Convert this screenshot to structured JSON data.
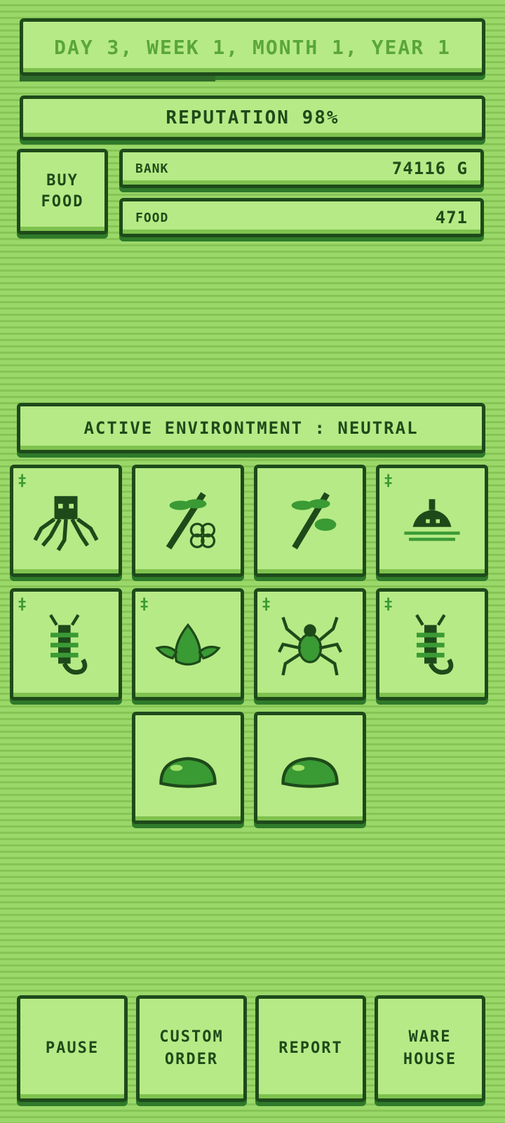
{
  "header": {
    "date_text": "DAY 3, WEEK 1, MONTH 1, YEAR 1",
    "reputation_text": "REPUTATION  98%",
    "date_progress": 0.42
  },
  "stats": {
    "buy_food_line1": "BUY",
    "buy_food_line2": "FOOD",
    "bank_label": "BANK",
    "bank_value": "74116 G",
    "food_label": "FOOD",
    "food_value": "471"
  },
  "environment": {
    "label": "ACTIVE ENVIRONTMENT : NEUTRAL"
  },
  "tiles": [
    {
      "creature": "octopus-icon",
      "plus": "‡"
    },
    {
      "creature": "plant-with-fruit-icon",
      "plus": ""
    },
    {
      "creature": "plant-sprout-icon",
      "plus": ""
    },
    {
      "creature": "water-creature-icon",
      "plus": "‡"
    },
    {
      "creature": "scorpion-icon",
      "plus": "‡"
    },
    {
      "creature": "seed-pod-icon",
      "plus": "‡"
    },
    {
      "creature": "spider-icon",
      "plus": "‡"
    },
    {
      "creature": "scorpion-icon",
      "plus": "‡"
    },
    {
      "creature": "slime-icon",
      "plus": ""
    },
    {
      "creature": "slime-icon",
      "plus": ""
    }
  ],
  "bottom_menu": {
    "pause": "PAUSE",
    "custom_line1": "CUSTOM",
    "custom_line2": "ORDER",
    "report": "REPORT",
    "warehouse_line1": "WARE",
    "warehouse_line2": "HOUSE"
  },
  "colors": {
    "background": "#8fcf5f",
    "panel": "#b6ea86",
    "dark": "#1e4a1a",
    "accent": "#3a9a34"
  }
}
